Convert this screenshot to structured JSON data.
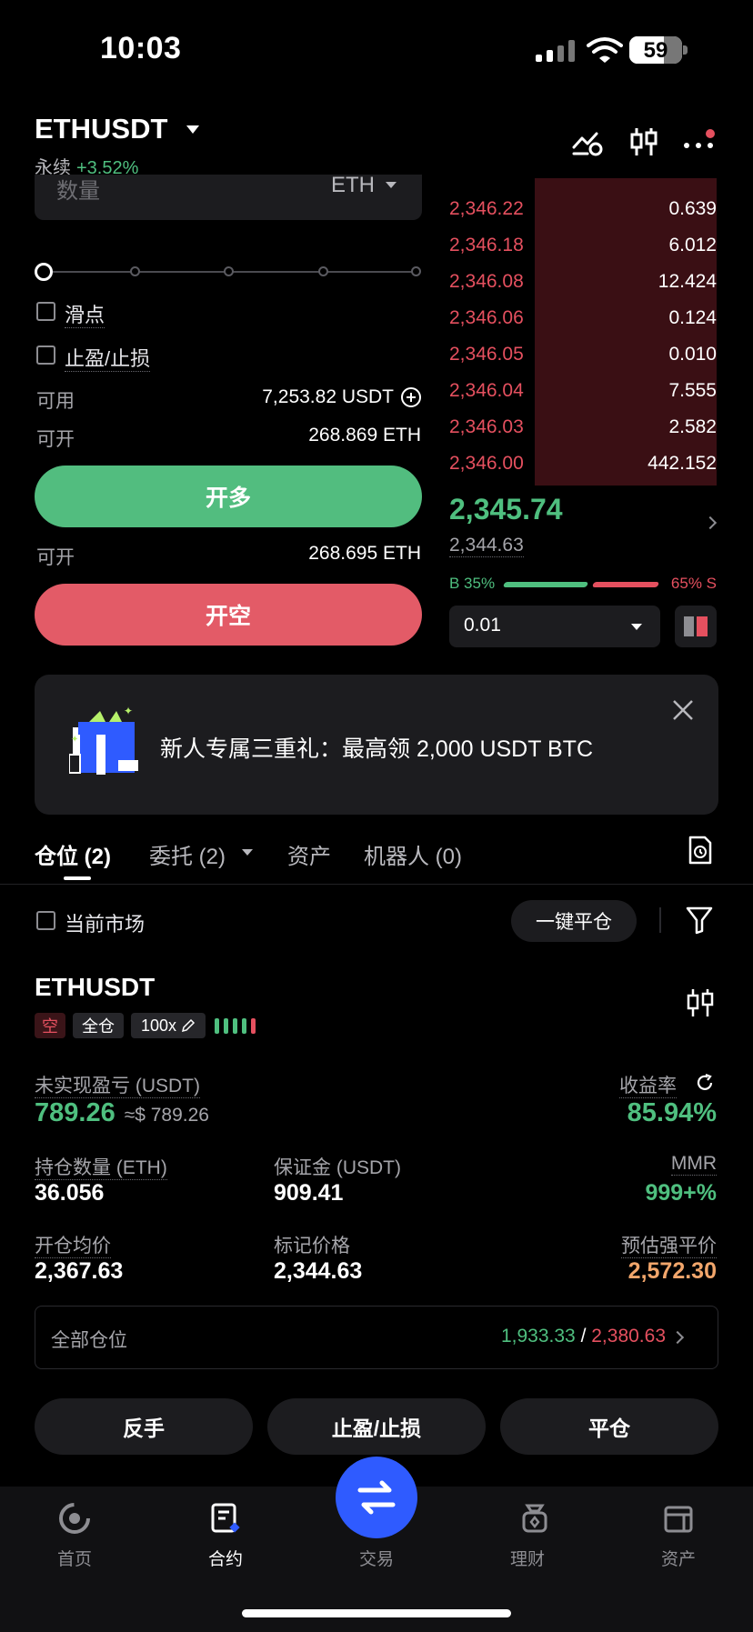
{
  "status": {
    "time": "10:03",
    "battery": "59"
  },
  "header": {
    "pair": "ETHUSDT",
    "type": "永续",
    "change": "+3.52%"
  },
  "form": {
    "qty_label": "数量",
    "qty_unit": "ETH",
    "slippage": "滑点",
    "tpsl": "止盈/止损",
    "available_label": "可用",
    "available_value": "7,253.82 USDT",
    "open_label": "可开",
    "open_long_value": "268.869 ETH",
    "long_button": "开多",
    "open_short_value": "268.695 ETH",
    "short_button": "开空"
  },
  "orderbook": {
    "asks": [
      {
        "price": "2,346.22",
        "qty": "0.639"
      },
      {
        "price": "2,346.18",
        "qty": "6.012"
      },
      {
        "price": "2,346.08",
        "qty": "12.424"
      },
      {
        "price": "2,346.06",
        "qty": "0.124"
      },
      {
        "price": "2,346.05",
        "qty": "0.010"
      },
      {
        "price": "2,346.04",
        "qty": "7.555"
      },
      {
        "price": "2,346.03",
        "qty": "2.582"
      },
      {
        "price": "2,346.00",
        "qty": "442.152"
      }
    ],
    "last_price": "2,345.74",
    "mark_price": "2,344.63",
    "buy_ratio": "B 35%",
    "sell_ratio": "65% S",
    "depth": "0.01"
  },
  "banner": {
    "text": "新人专属三重礼：最高领 2,000 USDT BTC"
  },
  "tabs": [
    {
      "label": "仓位 (2)"
    },
    {
      "label": "委托 (2)"
    },
    {
      "label": "资产"
    },
    {
      "label": "机器人 (0)"
    }
  ],
  "filter": {
    "current_market": "当前市场",
    "close_all": "一键平仓"
  },
  "position": {
    "pair": "ETHUSDT",
    "side": "空",
    "margin_mode": "全仓",
    "leverage": "100x",
    "upnl_label": "未实现盈亏 (USDT)",
    "upnl_value": "789.26",
    "upnl_usd": "≈$ 789.26",
    "roe_label": "收益率",
    "roe_value": "85.94%",
    "size_label": "持仓数量 (ETH)",
    "size_value": "36.056",
    "margin_label": "保证金 (USDT)",
    "margin_value": "909.41",
    "mmr_label": "MMR",
    "mmr_value": "999+%",
    "entry_label": "开仓均价",
    "entry_value": "2,367.63",
    "mark_label": "标记价格",
    "mark_value": "2,344.63",
    "liq_label": "预估强平价",
    "liq_value": "2,572.30"
  },
  "all_positions": {
    "label": "全部仓位",
    "green": "1,933.33",
    "sep": " / ",
    "red": "2,380.63"
  },
  "actions": {
    "reverse": "反手",
    "tpsl": "止盈/止损",
    "close": "平仓"
  },
  "nav": [
    {
      "label": "首页"
    },
    {
      "label": "合约"
    },
    {
      "label": "交易"
    },
    {
      "label": "理财"
    },
    {
      "label": "资产"
    }
  ],
  "colors": {
    "green": "#4fbf7f",
    "red": "#e5505f",
    "accent": "#2f5bff",
    "orange": "#f2a66b"
  }
}
